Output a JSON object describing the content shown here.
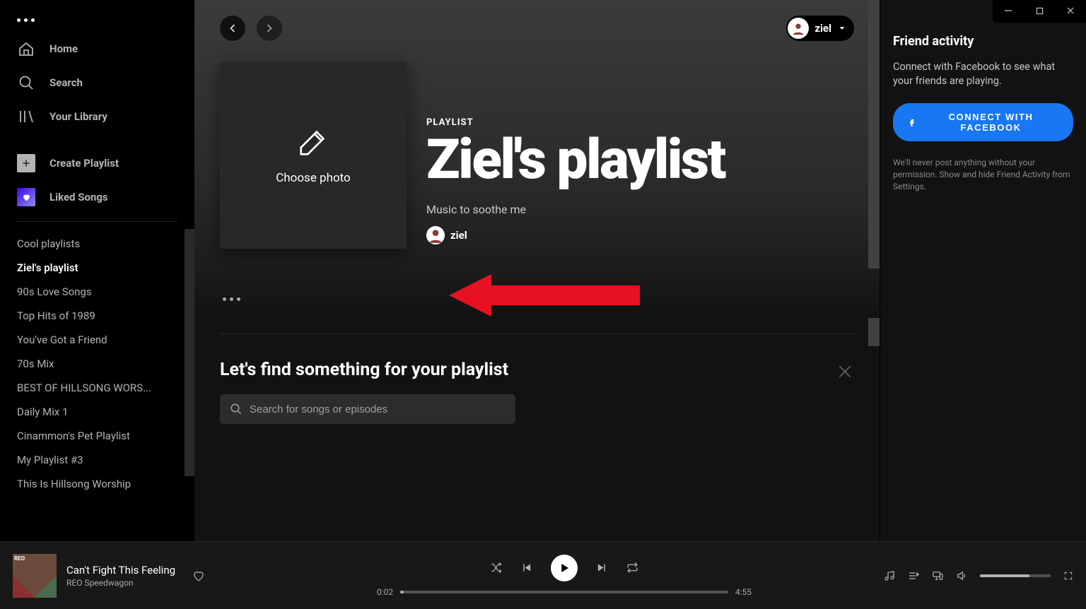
{
  "sidebar": {
    "nav": {
      "home": "Home",
      "search": "Search",
      "library": "Your Library",
      "create": "Create Playlist",
      "liked": "Liked Songs"
    },
    "playlists": [
      "Cool playlists",
      "Ziel's playlist",
      "90s Love Songs",
      "Top Hits of 1989",
      "You've Got a Friend",
      "70s Mix",
      "BEST OF HILLSONG WORS...",
      "Daily Mix 1",
      "Cinammon's Pet Playlist",
      "My Playlist #3",
      "This Is Hillsong Worship"
    ],
    "active_index": 1
  },
  "user": {
    "name": "ziel"
  },
  "header": {
    "type": "PLAYLIST",
    "title": "Ziel's playlist",
    "description": "Music to soothe me",
    "owner": "ziel",
    "choose_photo": "Choose photo"
  },
  "find": {
    "title": "Let's find something for your playlist",
    "placeholder": "Search for songs or episodes"
  },
  "friend": {
    "title": "Friend activity",
    "desc": "Connect with Facebook to see what your friends are playing.",
    "button": "CONNECT WITH FACEBOOK",
    "disclaimer": "We'll never post anything without your permission. Show and hide Friend Activity from Settings."
  },
  "player": {
    "track_title": "Can't Fight This Feeling",
    "track_artist": "REO Speedwagon",
    "elapsed": "0:02",
    "duration": "4:55"
  }
}
